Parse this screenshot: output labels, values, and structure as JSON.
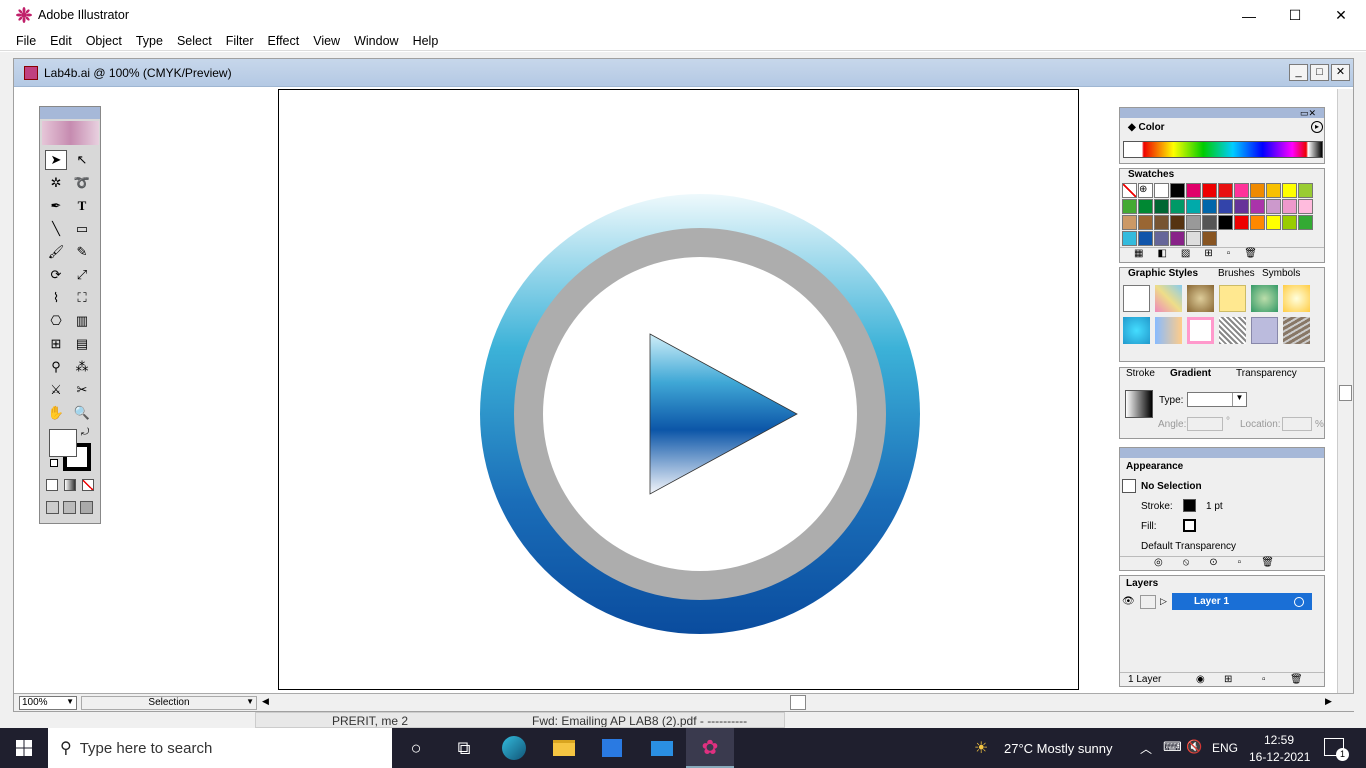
{
  "window": {
    "title": "Adobe Illustrator",
    "minimize": "—",
    "maximize": "☐",
    "close": "✕"
  },
  "menu": [
    "File",
    "Edit",
    "Object",
    "Type",
    "Select",
    "Filter",
    "Effect",
    "View",
    "Window",
    "Help"
  ],
  "document": {
    "title": "Lab4b.ai @ 100% (CMYK/Preview)"
  },
  "status": {
    "zoom": "100%",
    "mode": "Selection"
  },
  "panels": {
    "color": {
      "tab": "Color"
    },
    "swatches": {
      "tab": "Swatches"
    },
    "styles": {
      "tab1": "Graphic Styles",
      "tab2": "Brushes",
      "tab3": "Symbols"
    },
    "gradient": {
      "tab1": "Stroke",
      "tab2": "Gradient",
      "tab3": "Transparency",
      "type_label": "Type:",
      "angle_label": "Angle:",
      "location_label": "Location:",
      "pct": "%",
      "deg": "°"
    },
    "appearance": {
      "tab": "Appearance",
      "selection": "No Selection",
      "stroke_label": "Stroke:",
      "stroke_value": "1 pt",
      "fill_label": "Fill:",
      "transparency": "Default Transparency"
    },
    "layers": {
      "tab": "Layers",
      "layer_name": "Layer 1",
      "count": "1 Layer"
    }
  },
  "behind_window": {
    "text1": "PRERIT, me 2",
    "text2": "Fwd: Emailing AP LAB8 (2).pdf - ----------"
  },
  "taskbar": {
    "search_placeholder": "Type here to search",
    "weather": "27°C  Mostly sunny",
    "lang": "ENG",
    "time": "12:59",
    "date": "16-12-2021",
    "notif_count": "1"
  },
  "colors": {
    "ring_outer_top": "#e8f6fa",
    "ring_outer_mid": "#3aaed6",
    "ring_outer_bottom": "#0a4fa0",
    "ring_gray": "#adadad",
    "layer_highlight": "#1a6fd6"
  }
}
